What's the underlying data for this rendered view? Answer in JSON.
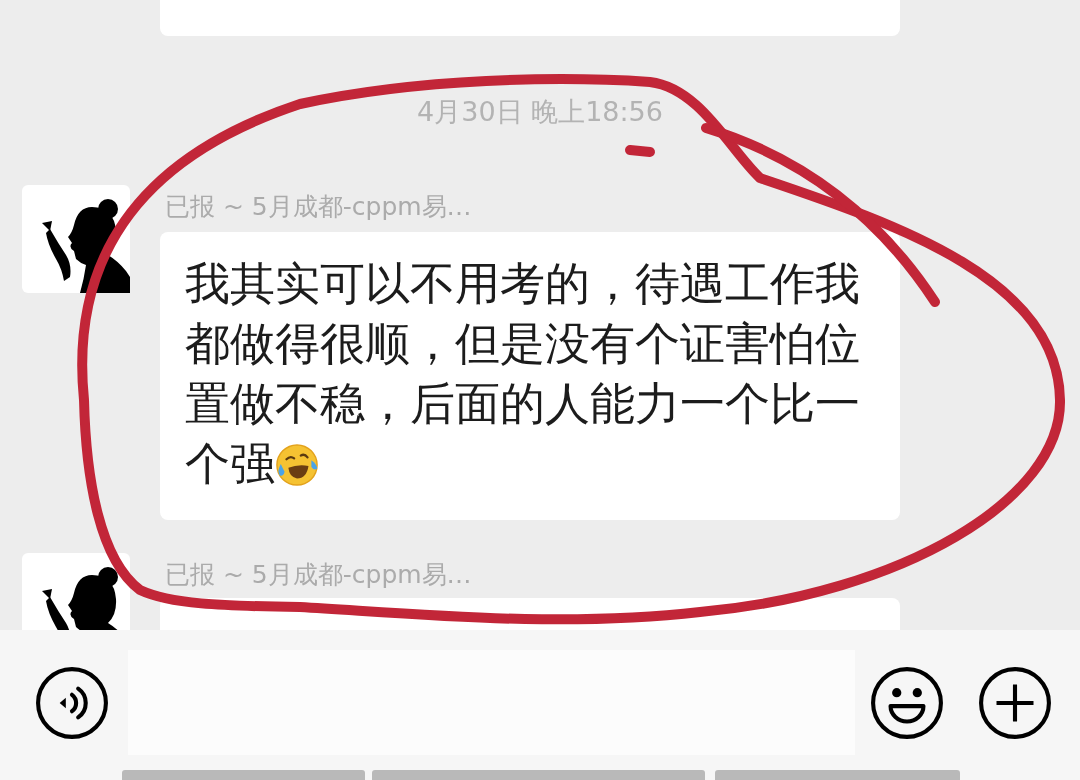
{
  "chat": {
    "messages": [
      {
        "kind": "clipped"
      },
      {
        "kind": "timestamp",
        "text": "4月30日 晚上18:56"
      },
      {
        "kind": "received",
        "sender": "已报 ~ 5月成都-cppm易…",
        "text": "我其实可以不用考的，待遇工作我都做得很顺，但是没有个证害怕位置做不稳，后面的人能力一个比一个强",
        "trailing_emoji": true
      },
      {
        "kind": "received",
        "sender": "已报 ~ 5月成都-cppm易…"
      }
    ]
  },
  "annotation": {
    "kind": "hand_drawn_circle"
  }
}
